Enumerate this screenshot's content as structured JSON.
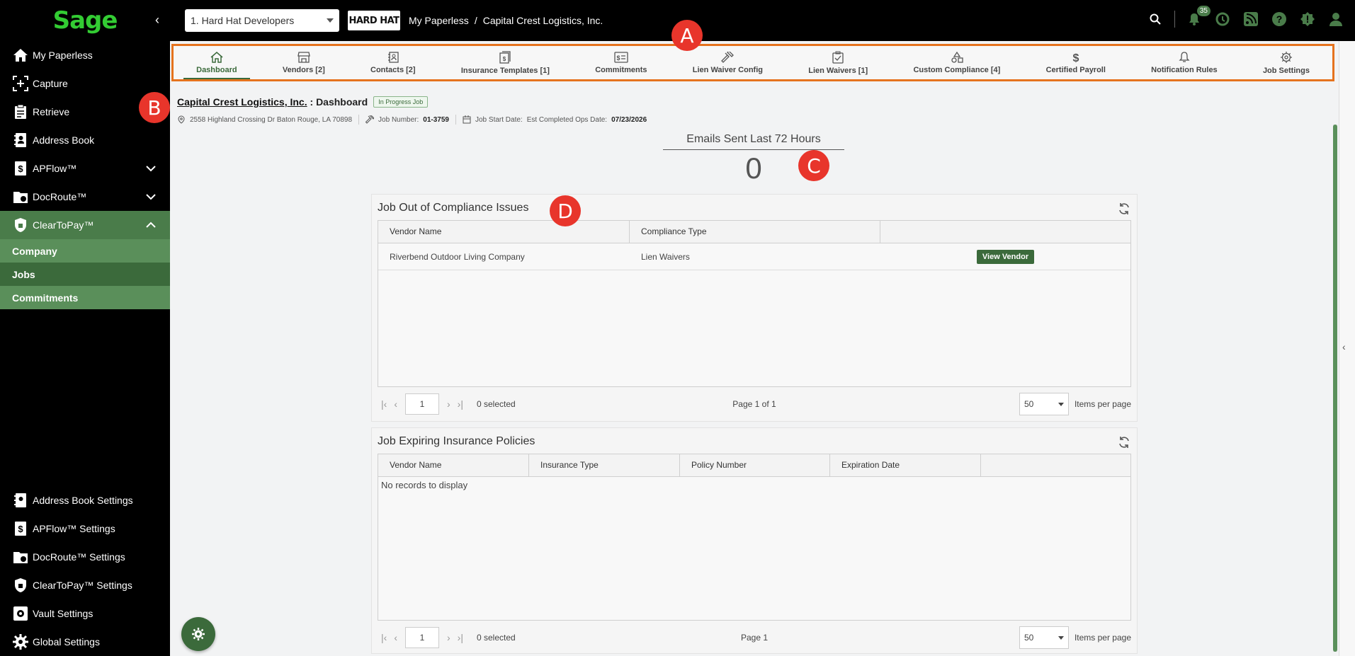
{
  "brand": {
    "logo_text": "Sage",
    "collapse_icon": "chevron-left-icon"
  },
  "topbar": {
    "company_select": "1. Hard Hat Developers",
    "company_logo_text": "HARD HAT",
    "breadcrumb": [
      "My Paperless",
      "/",
      "Capital Crest Logistics, Inc."
    ],
    "notification_count": "35"
  },
  "sidebar": {
    "items": [
      {
        "label": "My Paperless",
        "icon": "home-icon"
      },
      {
        "label": "Capture",
        "icon": "capture-icon"
      },
      {
        "label": "Retrieve",
        "icon": "retrieve-icon"
      },
      {
        "label": "Address Book",
        "icon": "address-book-icon"
      },
      {
        "label": "APFlow™",
        "icon": "apflow-icon"
      },
      {
        "label": "DocRoute™",
        "icon": "docroute-icon"
      },
      {
        "label": "ClearToPay™",
        "icon": "cleartopay-icon"
      }
    ],
    "subitems": [
      "Company",
      "Jobs",
      "Commitments"
    ],
    "bottom": [
      {
        "label": "Address Book Settings"
      },
      {
        "label": "APFlow™ Settings"
      },
      {
        "label": "DocRoute™ Settings"
      },
      {
        "label": "ClearToPay™ Settings"
      },
      {
        "label": "Vault Settings"
      },
      {
        "label": "Global Settings"
      }
    ]
  },
  "tabs": [
    {
      "label": "Dashboard",
      "icon": "home-icon"
    },
    {
      "label": "Vendors [2]",
      "icon": "store-icon"
    },
    {
      "label": "Contacts [2]",
      "icon": "contacts-icon"
    },
    {
      "label": "Insurance Templates [1]",
      "icon": "insurance-icon"
    },
    {
      "label": "Commitments",
      "icon": "commitments-icon"
    },
    {
      "label": "Lien Waiver Config",
      "icon": "hammer-icon"
    },
    {
      "label": "Lien Waivers [1]",
      "icon": "clipboard-check-icon"
    },
    {
      "label": "Custom Compliance [4]",
      "icon": "shapes-icon"
    },
    {
      "label": "Certified Payroll",
      "icon": "dollar-icon"
    },
    {
      "label": "Notification Rules",
      "icon": "bell-icon"
    },
    {
      "label": "Job Settings",
      "icon": "gear-icon"
    }
  ],
  "markers": [
    "A",
    "B",
    "C",
    "D"
  ],
  "job": {
    "name": "Capital Crest Logistics, Inc.",
    "separator": ":",
    "page": "Dashboard",
    "status": "In Progress Job",
    "address": "2558 Highland Crossing Dr Baton Rouge, LA 70898",
    "job_number_label": "Job Number:",
    "job_number": "01-3759",
    "start_date_label": "Job Start Date:",
    "est_completed_label": "Est Completed Ops Date:",
    "est_completed": "07/23/2026"
  },
  "emails": {
    "label": "Emails Sent Last 72 Hours",
    "count": "0"
  },
  "compliance": {
    "title": "Job Out of Compliance Issues",
    "columns": [
      "Vendor Name",
      "Compliance Type",
      ""
    ],
    "rows": [
      {
        "vendor": "Riverbend Outdoor Living Company",
        "type": "Lien Waivers",
        "action": "View Vendor"
      }
    ],
    "page": "1",
    "selected": "0 selected",
    "page_info": "Page 1 of 1",
    "per_page": "50",
    "per_page_label": "Items per page"
  },
  "insurance": {
    "title": "Job Expiring Insurance Policies",
    "columns": [
      "Vendor Name",
      "Insurance Type",
      "Policy Number",
      "Expiration Date",
      ""
    ],
    "empty": "No records to display",
    "page": "1",
    "selected": "0 selected",
    "page_info": "Page 1",
    "per_page": "50",
    "per_page_label": "Items per page"
  }
}
